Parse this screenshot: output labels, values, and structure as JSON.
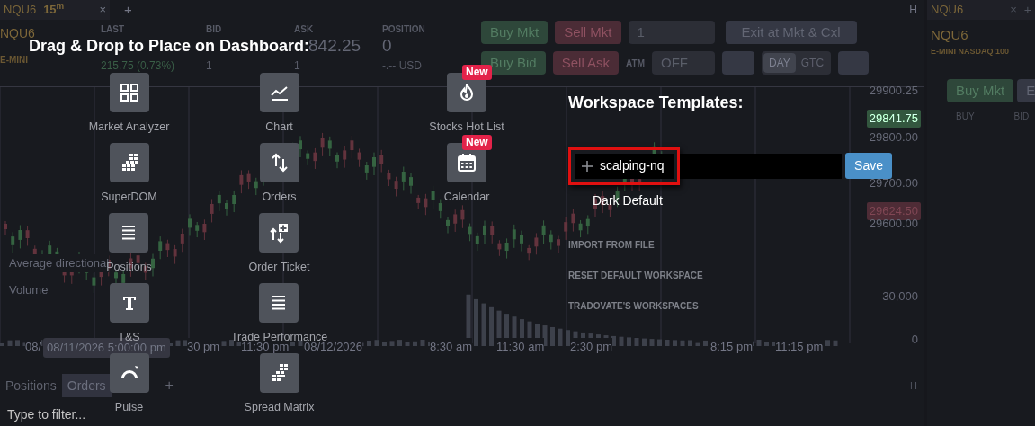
{
  "dashboard": {
    "main_tab": {
      "symbol": "NQU6",
      "interval": "15$^{m}$",
      "close": "×",
      "add": "+"
    },
    "quote": {
      "symbol": "NQU6",
      "description": "E-MINI",
      "fields": [
        {
          "label": "LAST",
          "sub": "215.75 (0.73%)"
        },
        {
          "label": "BID",
          "sub": "1"
        },
        {
          "label": "ASK",
          "value": "842.25",
          "sub": "1"
        },
        {
          "label": "POSITION",
          "value": "0",
          "sub": "-.-- USD"
        }
      ]
    },
    "order_bar": {
      "buy_market": "Buy Mkt",
      "sell_market": "Sell Mkt",
      "quantity": "1",
      "exit": "Exit at Mkt & Cxl",
      "buy_bid": "Buy Bid",
      "sell_ask": "Sell Ask",
      "atm_label": "ATM",
      "atm_value": "OFF",
      "durations": [
        {
          "label": "DAY",
          "selected": true
        },
        {
          "label": "GTC",
          "selected": false
        }
      ]
    },
    "window_controls": [
      "H"
    ],
    "price_labels": [
      {
        "text": "29900.25",
        "kind": "plain"
      },
      {
        "text": "29841.75",
        "kind": "last"
      },
      {
        "text": "29800.00",
        "kind": "plain"
      },
      {
        "text": "29700.00",
        "kind": "plain"
      },
      {
        "text": "29624.50",
        "kind": "marker"
      },
      {
        "text": "29600.00",
        "kind": "plain"
      },
      {
        "text": "30,000",
        "kind": "plain"
      },
      {
        "text": "0",
        "kind": "plain"
      }
    ],
    "indicators": [
      "Average directional",
      "Volume"
    ],
    "time_labels": [
      {
        "text": "08/",
        "kind": "plain"
      },
      {
        "text": "08/11/2026 5:00:00 pm",
        "kind": "cursor"
      },
      {
        "text": "30 pm",
        "kind": "plain"
      },
      {
        "text": "11:30 pm",
        "kind": "plain"
      },
      {
        "text": "08/12/2026",
        "kind": "plain"
      },
      {
        "text": "8:30 am",
        "kind": "plain"
      },
      {
        "text": "11:30 am",
        "kind": "plain"
      },
      {
        "text": "2:30 pm",
        "kind": "plain"
      },
      {
        "text": "8:15 pm",
        "kind": "plain"
      },
      {
        "text": "11:15 pm",
        "kind": "plain"
      }
    ],
    "bottom_tabs": [
      {
        "label": "Positions",
        "selected": false
      },
      {
        "label": "Orders",
        "selected": true
      }
    ],
    "bottom_add": "+",
    "filter_placeholder": "Type to filter...",
    "bottom_controls": [
      "H"
    ],
    "side_module": {
      "tab": "NQU6",
      "close": "×",
      "add": "+",
      "symbol": "NQU6",
      "description": "E-MINI NASDAQ 100",
      "buy_market": "Buy Mkt",
      "second_button": "E",
      "columns": [
        "BUY",
        "BID"
      ]
    }
  },
  "widgets_panel": {
    "title": "Drag & Drop to Place on Dashboard:",
    "columns": [
      [
        {
          "label": "Market Analyzer"
        },
        {
          "label": "SuperDOM"
        },
        {
          "label": "Positions"
        },
        {
          "label": "T&S"
        },
        {
          "label": "Pulse"
        }
      ],
      [
        {
          "label": "Chart"
        },
        {
          "label": "Orders"
        },
        {
          "label": "Order Ticket"
        },
        {
          "label": "Trade Performance"
        },
        {
          "label": "Spread Matrix"
        }
      ],
      [
        {
          "label": "Stocks Hot List",
          "badge": "New"
        },
        {
          "label": "Calendar",
          "badge": "New"
        }
      ]
    ]
  },
  "workspace_templates": {
    "title": "Workspace Templates:",
    "templates": [
      {
        "name": "scalping-nq",
        "selected": true,
        "save_button": "Save"
      },
      {
        "name": "Dark Default",
        "selected": false
      }
    ],
    "actions": [
      "IMPORT FROM FILE",
      "RESET DEFAULT WORKSPACE",
      "TRADOVATE'S WORKSPACES"
    ]
  }
}
